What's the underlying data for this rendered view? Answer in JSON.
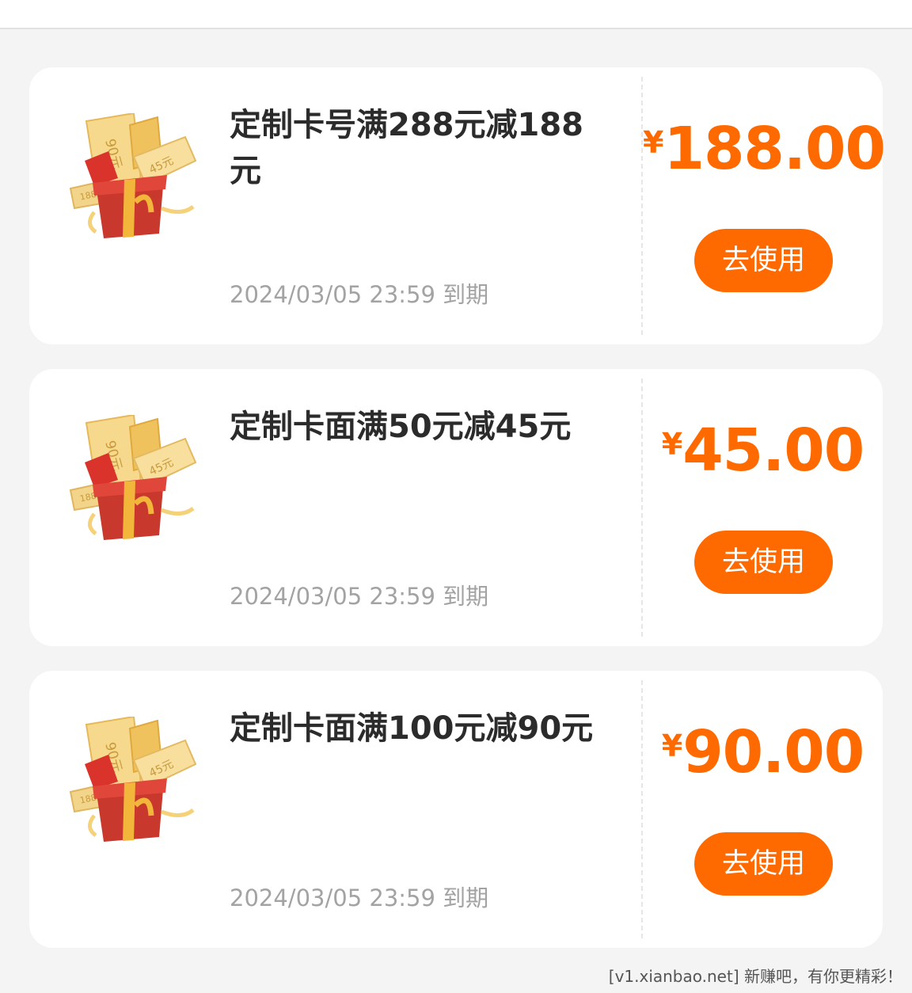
{
  "coupons": [
    {
      "title": "定制卡号满288元减188元",
      "currency": "¥",
      "amount": "188.00",
      "expiry": "2024/03/05 23:59 到期",
      "button_label": "去使用"
    },
    {
      "title": "定制卡面满50元减45元",
      "currency": "¥",
      "amount": "45.00",
      "expiry": "2024/03/05 23:59 到期",
      "button_label": "去使用"
    },
    {
      "title": "定制卡面满100元减90元",
      "currency": "¥",
      "amount": "90.00",
      "expiry": "2024/03/05 23:59 到期",
      "button_label": "去使用"
    }
  ],
  "gift_icon": {
    "name": "gift-box-coupons-icon",
    "ticket_labels": [
      "90元",
      "45元",
      "188元"
    ]
  },
  "colors": {
    "accent": "#ff6a00",
    "title_text": "#2b2b2b",
    "muted_text": "#a3a3a3",
    "background": "#f4f4f4",
    "card": "#ffffff"
  },
  "watermark": "[v1.xianbao.net] 新赚吧，有你更精彩！"
}
